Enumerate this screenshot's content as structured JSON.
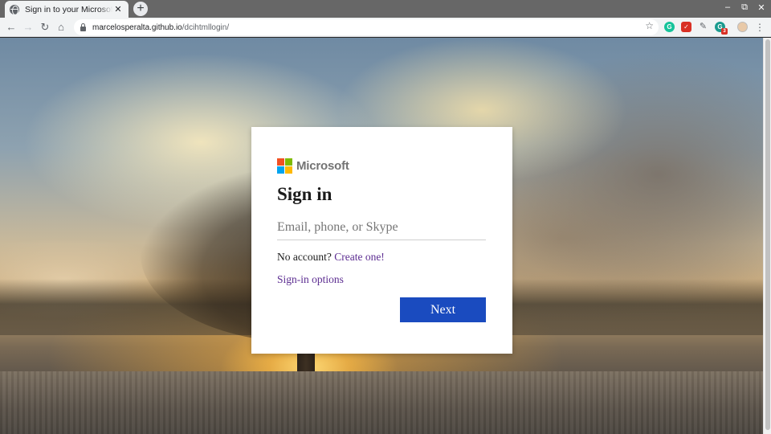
{
  "browser": {
    "tab": {
      "title": "Sign in to your Microsoft account"
    },
    "url": {
      "host": "marcelosperalta.github.io",
      "path": "/dcihtmllogin/"
    },
    "extensions": [
      {
        "name": "grammarly-icon",
        "color": "#15c39a",
        "glyph": "G"
      },
      {
        "name": "shield-icon",
        "color": "#d93025",
        "glyph": "✓"
      },
      {
        "name": "eyedropper-icon",
        "color": "#5f6368",
        "glyph": ""
      },
      {
        "name": "extension-badge-icon",
        "color": "#1a9b8f",
        "glyph": "G",
        "badge": "3"
      }
    ]
  },
  "signin": {
    "brand": "Microsoft",
    "brand_colors": [
      "#f25022",
      "#7fba00",
      "#00a4ef",
      "#ffb900"
    ],
    "title": "Sign in",
    "email_placeholder": "Email, phone, or Skype",
    "email_value": "",
    "no_account_text": "No account?",
    "create_link": "Create one!",
    "options_link": "Sign-in options",
    "next_label": "Next"
  },
  "colors": {
    "link": "#5c2d91",
    "primary_button": "#1a4bbf"
  }
}
